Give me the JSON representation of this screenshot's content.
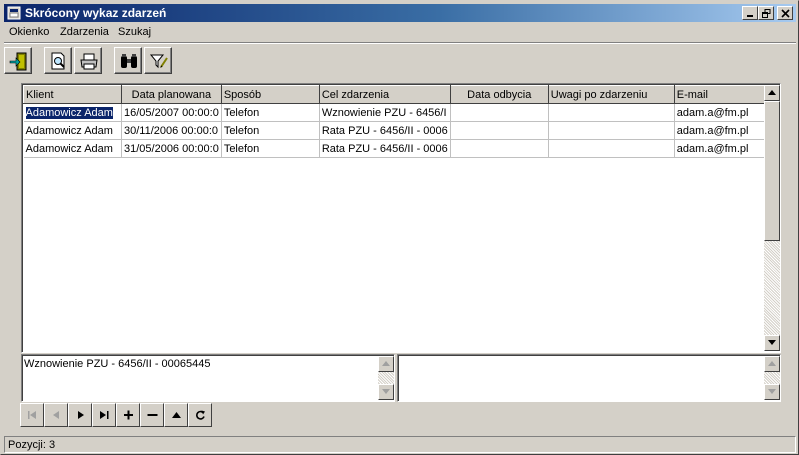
{
  "window": {
    "title": "Skrócony wykaz zdarzeń"
  },
  "menu": {
    "items": [
      "Okienko",
      "Zdarzenia",
      "Szukaj"
    ]
  },
  "toolbar": {
    "buttons": [
      "exit-icon",
      "preview-icon",
      "print-icon",
      "binoculars-icon",
      "filter-icon"
    ]
  },
  "grid": {
    "columns": [
      "Klient",
      "Data planowana",
      "Sposób",
      "Cel zdarzenia",
      "Data odbycia",
      "Uwagi po zdarzeniu",
      "E-mail"
    ],
    "rows": [
      [
        "Adamowicz Adam",
        "16/05/2007 00:00:0",
        "Telefon",
        "Wznowienie PZU - 6456/I",
        "",
        "",
        "adam.a@fm.pl"
      ],
      [
        "Adamowicz Adam",
        "30/11/2006 00:00:0",
        "Telefon",
        "Rata PZU - 6456/II - 0006",
        "",
        "",
        "adam.a@fm.pl"
      ],
      [
        "Adamowicz Adam",
        "31/05/2006 00:00:0",
        "Telefon",
        "Rata PZU - 6456/II - 0006",
        "",
        "",
        "adam.a@fm.pl"
      ]
    ]
  },
  "memo_left": {
    "text": "Wznowienie PZU - 6456/II - 00065445"
  },
  "memo_right": {
    "text": ""
  },
  "navigator": {
    "buttons": [
      "first-icon",
      "prior-icon",
      "next-icon",
      "last-icon",
      "insert-icon",
      "delete-icon",
      "post-icon",
      "refresh-icon"
    ]
  },
  "status": {
    "text": "Pozycji: 3"
  },
  "colors": {
    "title_start": "#0a246a",
    "title_end": "#a6caf0",
    "face": "#d4d0c8",
    "selection": "#0a246a"
  }
}
